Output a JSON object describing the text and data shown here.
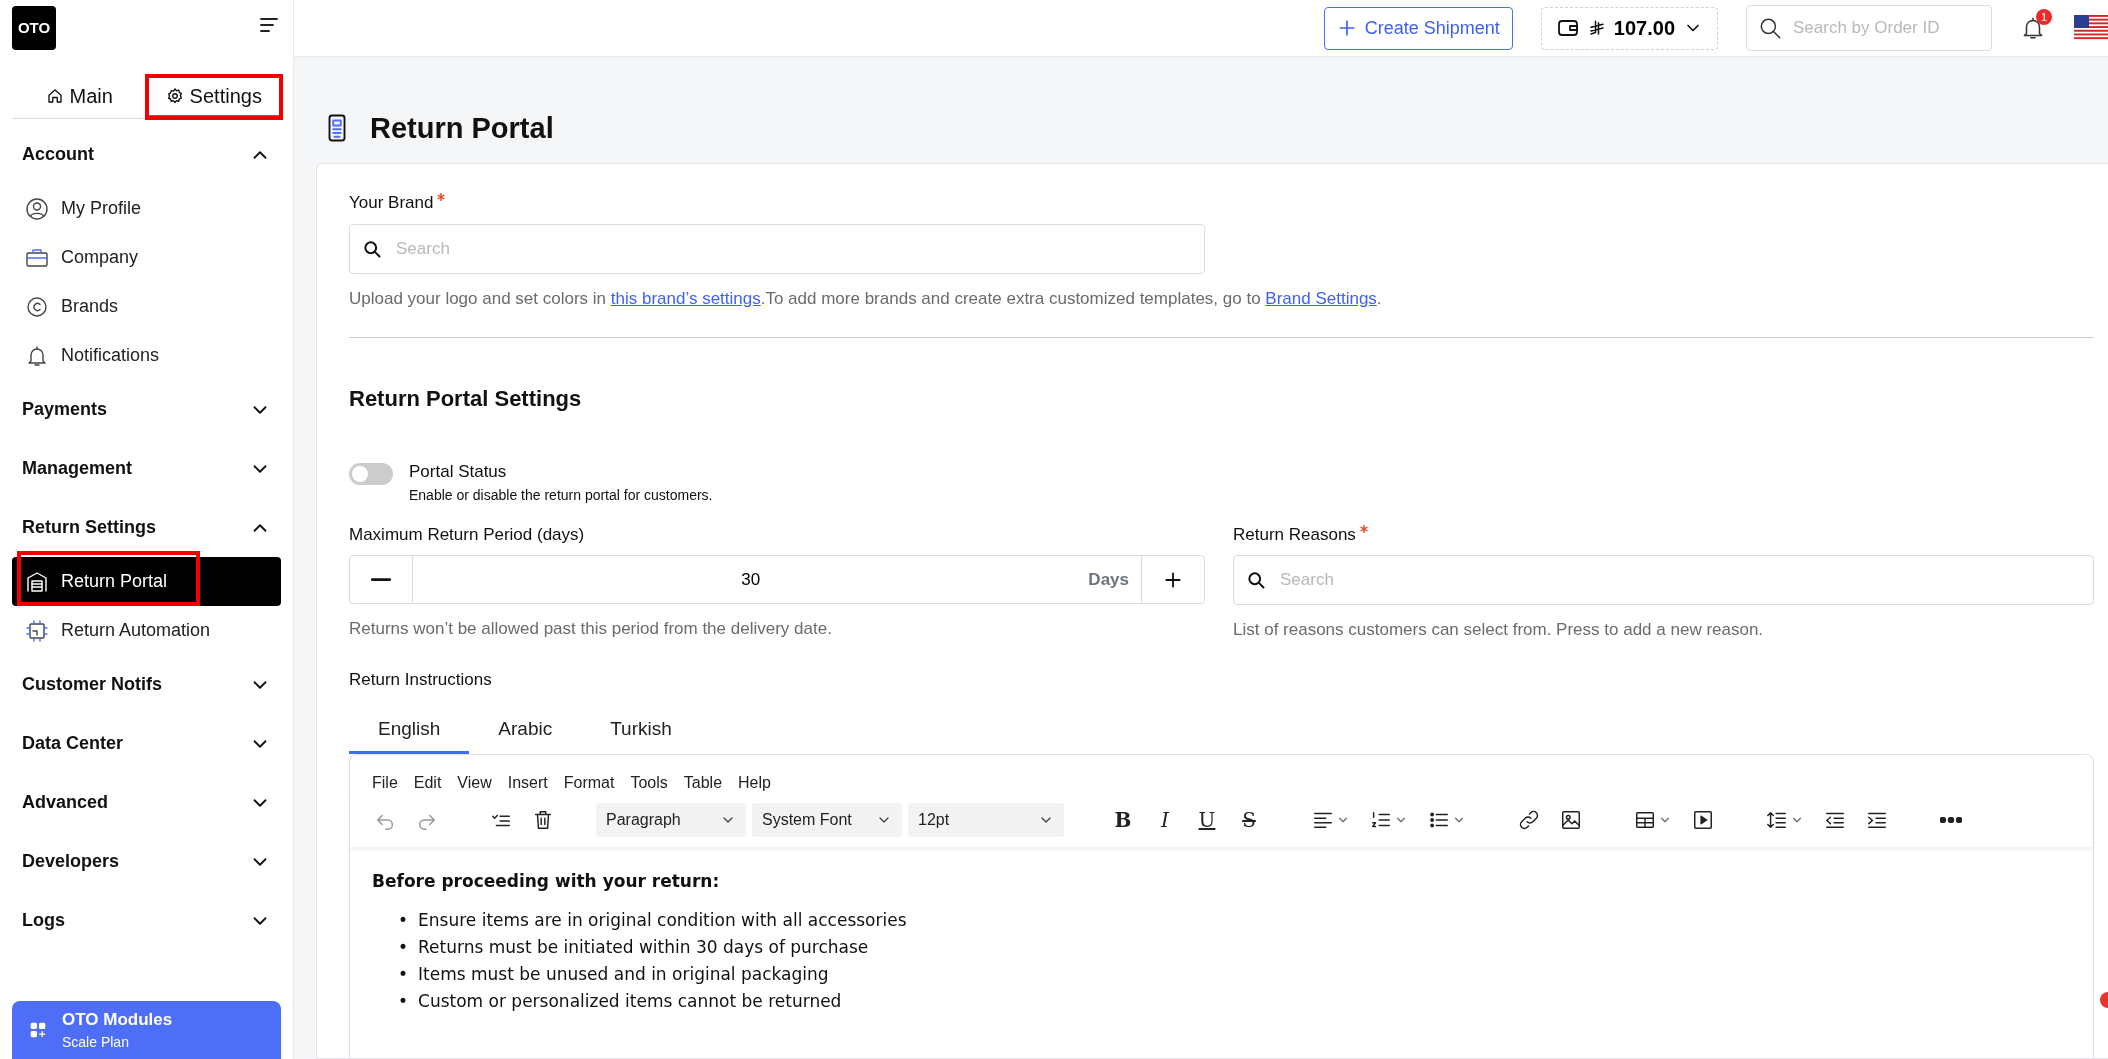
{
  "logo": "OTO",
  "nav_tabs": [
    {
      "label": "Main",
      "selected": false,
      "highlighted": false
    },
    {
      "label": "Settings",
      "selected": true,
      "highlighted": true
    }
  ],
  "sidebar": [
    {
      "label": "Account",
      "expanded": true,
      "children": [
        {
          "label": "My Profile",
          "selected": false,
          "highlighted": false
        },
        {
          "label": "Company",
          "selected": false,
          "highlighted": false
        },
        {
          "label": "Brands",
          "selected": false,
          "highlighted": false
        },
        {
          "label": "Notifications",
          "selected": false,
          "highlighted": false
        }
      ]
    },
    {
      "label": "Payments",
      "expanded": false
    },
    {
      "label": "Management",
      "expanded": false
    },
    {
      "label": "Return Settings",
      "expanded": true,
      "children": [
        {
          "label": "Return Portal",
          "selected": true,
          "highlighted": true
        },
        {
          "label": "Return Automation",
          "selected": false,
          "highlighted": false
        }
      ]
    },
    {
      "label": "Customer Notifs",
      "expanded": false
    },
    {
      "label": "Data Center",
      "expanded": false
    },
    {
      "label": "Advanced",
      "expanded": false
    },
    {
      "label": "Developers",
      "expanded": false
    },
    {
      "label": "Logs",
      "expanded": false
    }
  ],
  "modules_card": {
    "title": "OTO Modules",
    "subtitle": "Scale Plan"
  },
  "topbar": {
    "create_button": "Create Shipment",
    "balance": "107.00",
    "search_placeholder": "Search by Order ID",
    "notification_count": "1"
  },
  "page_title": "Return Portal",
  "brand_field": {
    "label": "Your Brand",
    "required": true,
    "placeholder": "Search"
  },
  "brand_help": [
    {
      "kind": "text",
      "text": "Upload your logo and set colors in"
    },
    {
      "kind": "link",
      "text": "this brand’s settings"
    },
    {
      "kind": "text",
      "text": ".To add more brands and create extra customized templates, go to"
    },
    {
      "kind": "link",
      "text": "Brand Settings"
    },
    {
      "kind": "text",
      "text": "."
    }
  ],
  "section_title": "Return Portal Settings",
  "portal_status": {
    "label": "Portal Status",
    "description": "Enable or disable the return portal for customers.",
    "on": false
  },
  "period_field": {
    "label": "Maximum Return Period (days)",
    "value": "30",
    "unit": "Days",
    "help": "Returns won’t be allowed past this period from the delivery date."
  },
  "reasons_field": {
    "label": "Return Reasons",
    "required": true,
    "placeholder": "Search",
    "help": "List of reasons customers can select from. Press to add a new reason."
  },
  "instructions_label": "Return Instructions",
  "language_tabs": [
    {
      "label": "English",
      "selected": true
    },
    {
      "label": "Arabic",
      "selected": false
    },
    {
      "label": "Turkish",
      "selected": false
    }
  ],
  "editor": {
    "menu": [
      "File",
      "Edit",
      "View",
      "Insert",
      "Format",
      "Tools",
      "Table",
      "Help"
    ],
    "block_format": "Paragraph",
    "font": "System Font",
    "font_size": "12pt",
    "format_buttons": [
      "B",
      "I",
      "U",
      "S"
    ],
    "heading": "Before proceeding with your return:",
    "bullet_marker": "•",
    "bullets": [
      "Ensure items are in original condition with all accessories",
      "Returns must be initiated within 30 days of purchase",
      "Items must be unused and in original packaging",
      "Custom or personalized items cannot be returned"
    ]
  }
}
